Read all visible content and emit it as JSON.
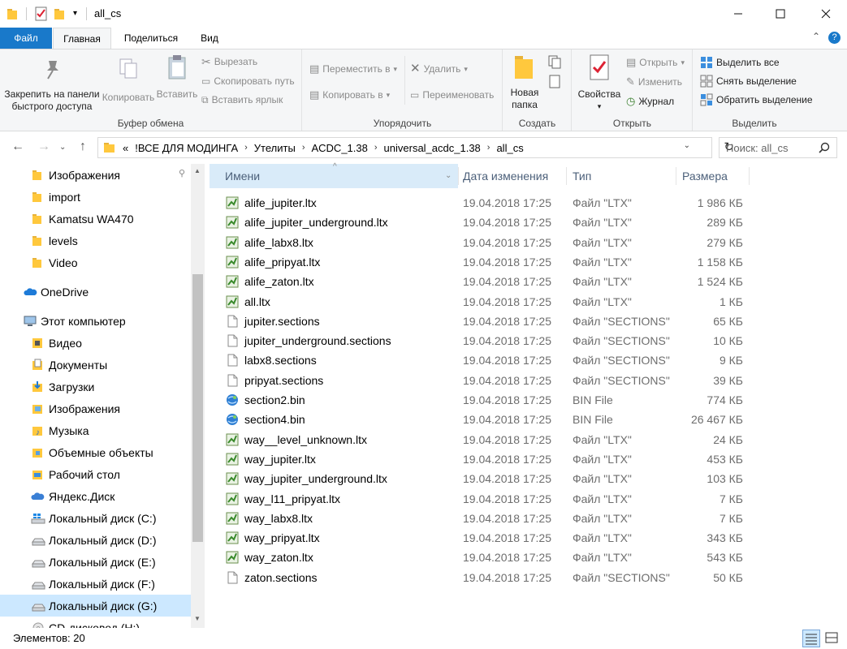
{
  "window": {
    "title": "all_cs"
  },
  "tabs": {
    "file": "Файл",
    "home": "Главная",
    "share": "Поделиться",
    "view": "Вид"
  },
  "ribbon": {
    "clipboard": {
      "label": "Буфер обмена",
      "pin": "Закрепить на панели быстрого доступа",
      "copy": "Копировать",
      "paste": "Вставить",
      "cut": "Вырезать",
      "copy_path": "Скопировать путь",
      "paste_shortcut": "Вставить ярлык"
    },
    "organize": {
      "label": "Упорядочить",
      "move_to": "Переместить в",
      "copy_to": "Копировать в",
      "delete": "Удалить",
      "rename": "Переименовать"
    },
    "new": {
      "label": "Создать",
      "new_folder": "Новая папка"
    },
    "open": {
      "label": "Открыть",
      "properties": "Свойства",
      "open": "Открыть",
      "edit": "Изменить",
      "history": "Журнал"
    },
    "select": {
      "label": "Выделить",
      "select_all": "Выделить все",
      "select_none": "Снять выделение",
      "invert": "Обратить выделение"
    }
  },
  "address": {
    "crumbs": [
      "!ВСЕ ДЛЯ МОДИНГА",
      "Утелиты",
      "ACDC_1.38",
      "universal_acdc_1.38",
      "all_cs"
    ],
    "overflow": "«",
    "search_placeholder": "Поиск: all_cs"
  },
  "nav": [
    {
      "label": "Изображения",
      "icon": "folder-icon",
      "pinned": true
    },
    {
      "label": "import",
      "icon": "folder-icon"
    },
    {
      "label": "Kamatsu WA470",
      "icon": "folder-icon"
    },
    {
      "label": "levels",
      "icon": "folder-icon"
    },
    {
      "label": "Video",
      "icon": "folder-icon"
    },
    {
      "label": "OneDrive",
      "icon": "cloud-icon"
    },
    {
      "label": "Этот компьютер",
      "icon": "computer-icon"
    },
    {
      "label": "Видео",
      "icon": "video-folder-icon"
    },
    {
      "label": "Документы",
      "icon": "documents-icon"
    },
    {
      "label": "Загрузки",
      "icon": "downloads-icon"
    },
    {
      "label": "Изображения",
      "icon": "pictures-icon"
    },
    {
      "label": "Музыка",
      "icon": "music-icon"
    },
    {
      "label": "Объемные объекты",
      "icon": "3d-objects-icon"
    },
    {
      "label": "Рабочий стол",
      "icon": "desktop-icon"
    },
    {
      "label": "Яндекс.Диск",
      "icon": "yandex-disk-icon"
    },
    {
      "label": "Локальный диск (C:)",
      "icon": "windows-drive-icon"
    },
    {
      "label": "Локальный диск (D:)",
      "icon": "drive-icon"
    },
    {
      "label": "Локальный диск (E:)",
      "icon": "drive-icon"
    },
    {
      "label": "Локальный диск (F:)",
      "icon": "drive-icon"
    },
    {
      "label": "Локальный диск (G:)",
      "icon": "drive-icon",
      "selected": true
    },
    {
      "label": "CD-дисковод (H:)",
      "icon": "cd-drive-icon"
    }
  ],
  "columns": {
    "name": "Имени",
    "date": "Дата изменения",
    "type": "Тип",
    "size": "Размера"
  },
  "files": [
    {
      "name": "alife_jupiter.ltx",
      "date": "19.04.2018 17:25",
      "type": "Файл \"LTX\"",
      "size": "1 986 КБ",
      "icon": "ltx"
    },
    {
      "name": "alife_jupiter_underground.ltx",
      "date": "19.04.2018 17:25",
      "type": "Файл \"LTX\"",
      "size": "289 КБ",
      "icon": "ltx"
    },
    {
      "name": "alife_labx8.ltx",
      "date": "19.04.2018 17:25",
      "type": "Файл \"LTX\"",
      "size": "279 КБ",
      "icon": "ltx"
    },
    {
      "name": "alife_pripyat.ltx",
      "date": "19.04.2018 17:25",
      "type": "Файл \"LTX\"",
      "size": "1 158 КБ",
      "icon": "ltx"
    },
    {
      "name": "alife_zaton.ltx",
      "date": "19.04.2018 17:25",
      "type": "Файл \"LTX\"",
      "size": "1 524 КБ",
      "icon": "ltx"
    },
    {
      "name": "all.ltx",
      "date": "19.04.2018 17:25",
      "type": "Файл \"LTX\"",
      "size": "1 КБ",
      "icon": "ltx"
    },
    {
      "name": "jupiter.sections",
      "date": "19.04.2018 17:25",
      "type": "Файл \"SECTIONS\"",
      "size": "65 КБ",
      "icon": "blank"
    },
    {
      "name": "jupiter_underground.sections",
      "date": "19.04.2018 17:25",
      "type": "Файл \"SECTIONS\"",
      "size": "10 КБ",
      "icon": "blank"
    },
    {
      "name": "labx8.sections",
      "date": "19.04.2018 17:25",
      "type": "Файл \"SECTIONS\"",
      "size": "9 КБ",
      "icon": "blank"
    },
    {
      "name": "pripyat.sections",
      "date": "19.04.2018 17:25",
      "type": "Файл \"SECTIONS\"",
      "size": "39 КБ",
      "icon": "blank"
    },
    {
      "name": "section2.bin",
      "date": "19.04.2018 17:25",
      "type": "BIN File",
      "size": "774 КБ",
      "icon": "bin"
    },
    {
      "name": "section4.bin",
      "date": "19.04.2018 17:25",
      "type": "BIN File",
      "size": "26 467 КБ",
      "icon": "bin"
    },
    {
      "name": "way__level_unknown.ltx",
      "date": "19.04.2018 17:25",
      "type": "Файл \"LTX\"",
      "size": "24 КБ",
      "icon": "ltx"
    },
    {
      "name": "way_jupiter.ltx",
      "date": "19.04.2018 17:25",
      "type": "Файл \"LTX\"",
      "size": "453 КБ",
      "icon": "ltx"
    },
    {
      "name": "way_jupiter_underground.ltx",
      "date": "19.04.2018 17:25",
      "type": "Файл \"LTX\"",
      "size": "103 КБ",
      "icon": "ltx"
    },
    {
      "name": "way_l11_pripyat.ltx",
      "date": "19.04.2018 17:25",
      "type": "Файл \"LTX\"",
      "size": "7 КБ",
      "icon": "ltx"
    },
    {
      "name": "way_labx8.ltx",
      "date": "19.04.2018 17:25",
      "type": "Файл \"LTX\"",
      "size": "7 КБ",
      "icon": "ltx"
    },
    {
      "name": "way_pripyat.ltx",
      "date": "19.04.2018 17:25",
      "type": "Файл \"LTX\"",
      "size": "343 КБ",
      "icon": "ltx"
    },
    {
      "name": "way_zaton.ltx",
      "date": "19.04.2018 17:25",
      "type": "Файл \"LTX\"",
      "size": "543 КБ",
      "icon": "ltx"
    },
    {
      "name": "zaton.sections",
      "date": "19.04.2018 17:25",
      "type": "Файл \"SECTIONS\"",
      "size": "50 КБ",
      "icon": "blank"
    }
  ],
  "status": {
    "items": "Элементов: 20"
  },
  "colors": {
    "accent": "#1979ca",
    "selection": "#cce8ff",
    "folder": "#ffc83d"
  }
}
